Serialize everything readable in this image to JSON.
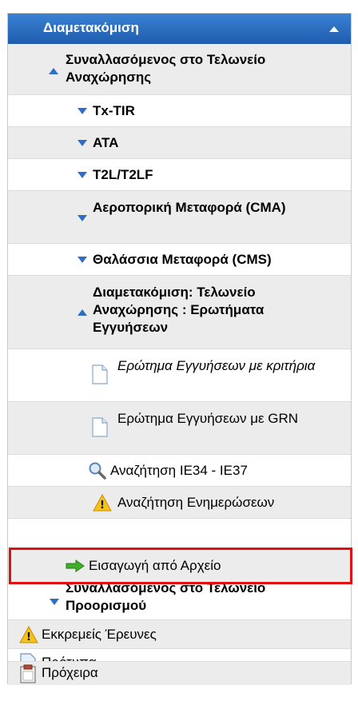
{
  "header": {
    "title": "Διαμετακόμιση"
  },
  "items": {
    "departure_trader": "Συναλλασόμενος στο Τελωνείο Αναχώρησης",
    "tx_tir": "Tx-TIR",
    "ata": "ATA",
    "t2l": "T2L/T2LF",
    "air": "Αεροπορική Μεταφορά (CMA)",
    "sea": "Θαλάσσια Μεταφορά (CMS)",
    "guarantee_queries": "Διαμετακόμιση: Τελωνείο Αναχώρησης : Ερωτήματα Εγγυήσεων",
    "guarantee_criteria": "Ερώτημα Εγγυήσεων με κριτήρια",
    "guarantee_grn": "Ερώτημα Εγγυήσεων με GRN",
    "search_ie34": "Αναζήτηση IE34 - IE37",
    "search_updates": "Αναζήτηση Ενημερώσεων",
    "import_file": "Εισαγωγή από Αρχείο",
    "destination_trader": "Συναλλασόμενος στο Τελωνείο Προορισμού",
    "pending_investigations": "Εκκρεμείς Έρευνες",
    "templates": "Πρότυπα",
    "drafts": "Πρόχειρα"
  }
}
